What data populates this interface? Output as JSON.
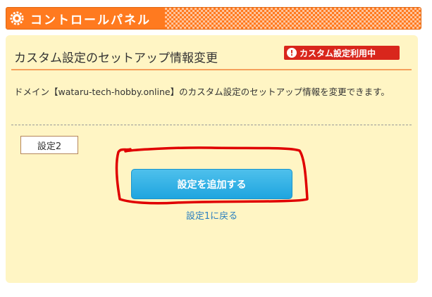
{
  "header": {
    "title": "コントロールパネル"
  },
  "panel": {
    "title": "カスタム設定のセットアップ情報変更",
    "badge": {
      "icon_text": "!",
      "label": "カスタム設定利用中"
    },
    "description": "ドメイン【wataru-tech-hobby.online】のカスタム設定のセットアップ情報を変更できます。",
    "setting_chip": "設定2",
    "add_button": "設定を追加する",
    "back_link": "設定1に戻る"
  },
  "colors": {
    "header_orange": "#ff7a1f",
    "panel_bg": "#fff5c4",
    "badge_red": "#d9261c",
    "button_blue": "#1fa5df",
    "link_blue": "#2a7fc0",
    "annotation_red": "#e00000"
  },
  "icons": {
    "header": "gear-icon",
    "badge": "exclamation-icon"
  }
}
